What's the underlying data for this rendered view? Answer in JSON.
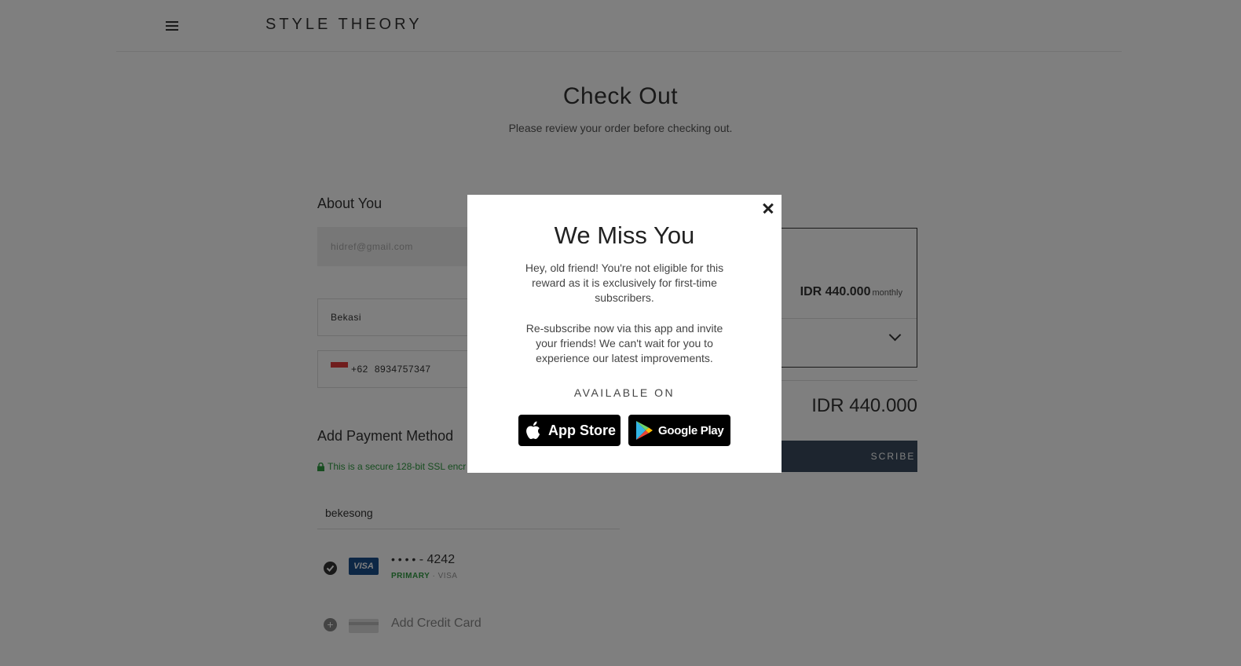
{
  "header": {
    "brand": "STYLE THEORY"
  },
  "page": {
    "title": "Check Out",
    "subtitle": "Please review your order before checking out."
  },
  "about_you": {
    "title": "About You",
    "email": "hidref@gmail.com",
    "city": "Bekasi",
    "phone_code": "+62",
    "phone": "8934757347"
  },
  "payment": {
    "title": "Add Payment Method",
    "secure_note": "This is a secure 128-bit SSL encr",
    "cardholder": "bekesong",
    "card_masked": "• • • •",
    "card_last4": "- 4242",
    "card_badge": "VISA",
    "card_primary": "PRIMARY",
    "card_separator": " · ",
    "card_brand": "VISA",
    "add_card": "Add Credit Card"
  },
  "plan": {
    "price": "IDR 440.000",
    "period": "monthly",
    "total": "IDR 440.000",
    "subscribe_label": "SCRIBE"
  },
  "modal": {
    "title": "We Miss You",
    "text1": "Hey, old friend! You're not eligible for this reward as it is exclusively for first-time subscribers.",
    "text2": "Re-subscribe now via this app and invite your friends! We can't wait for you to experience our latest improvements.",
    "available_on": "AVAILABLE ON",
    "app_store": "App Store",
    "google_play": "Google Play"
  },
  "colors": {
    "overlay": "rgba(0,0,0,0.5)",
    "secure_green": "#2e9a40",
    "subscribe_bg": "#3a4a5e"
  }
}
